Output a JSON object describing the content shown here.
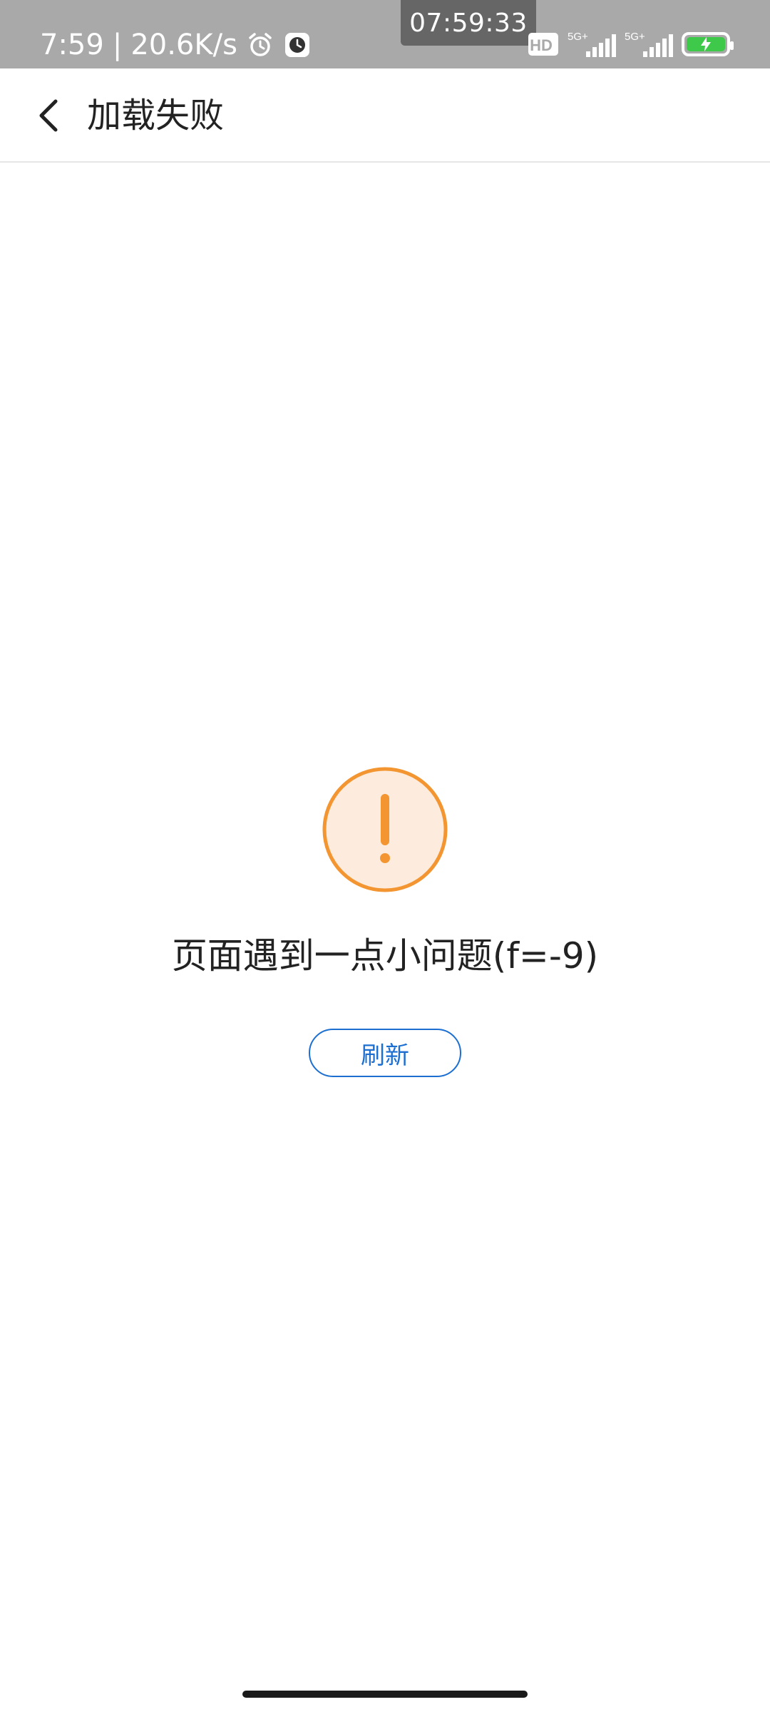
{
  "status_bar": {
    "time": "7:59",
    "separator": "|",
    "net_speed": "20.6K/s",
    "screen_clock": "07:59:33",
    "icons": [
      "alarm-icon",
      "clock-icon",
      "hd-icon",
      "signal-5g-icon",
      "signal-5g-icon",
      "battery-charging-icon"
    ],
    "sim1_label": "5G+",
    "sim2_label": "5G+",
    "hd_label": "HD",
    "battery_color": "#3fc94a"
  },
  "header": {
    "back_icon": "chevron-left-icon",
    "title": "加载失败"
  },
  "error": {
    "icon": "exclamation-circle-icon",
    "icon_color": "#f39632",
    "icon_bg": "#fdebdd",
    "message": "页面遇到一点小问题(f=-9)",
    "refresh_label": "刷新",
    "accent_color": "#1c6fd1"
  }
}
